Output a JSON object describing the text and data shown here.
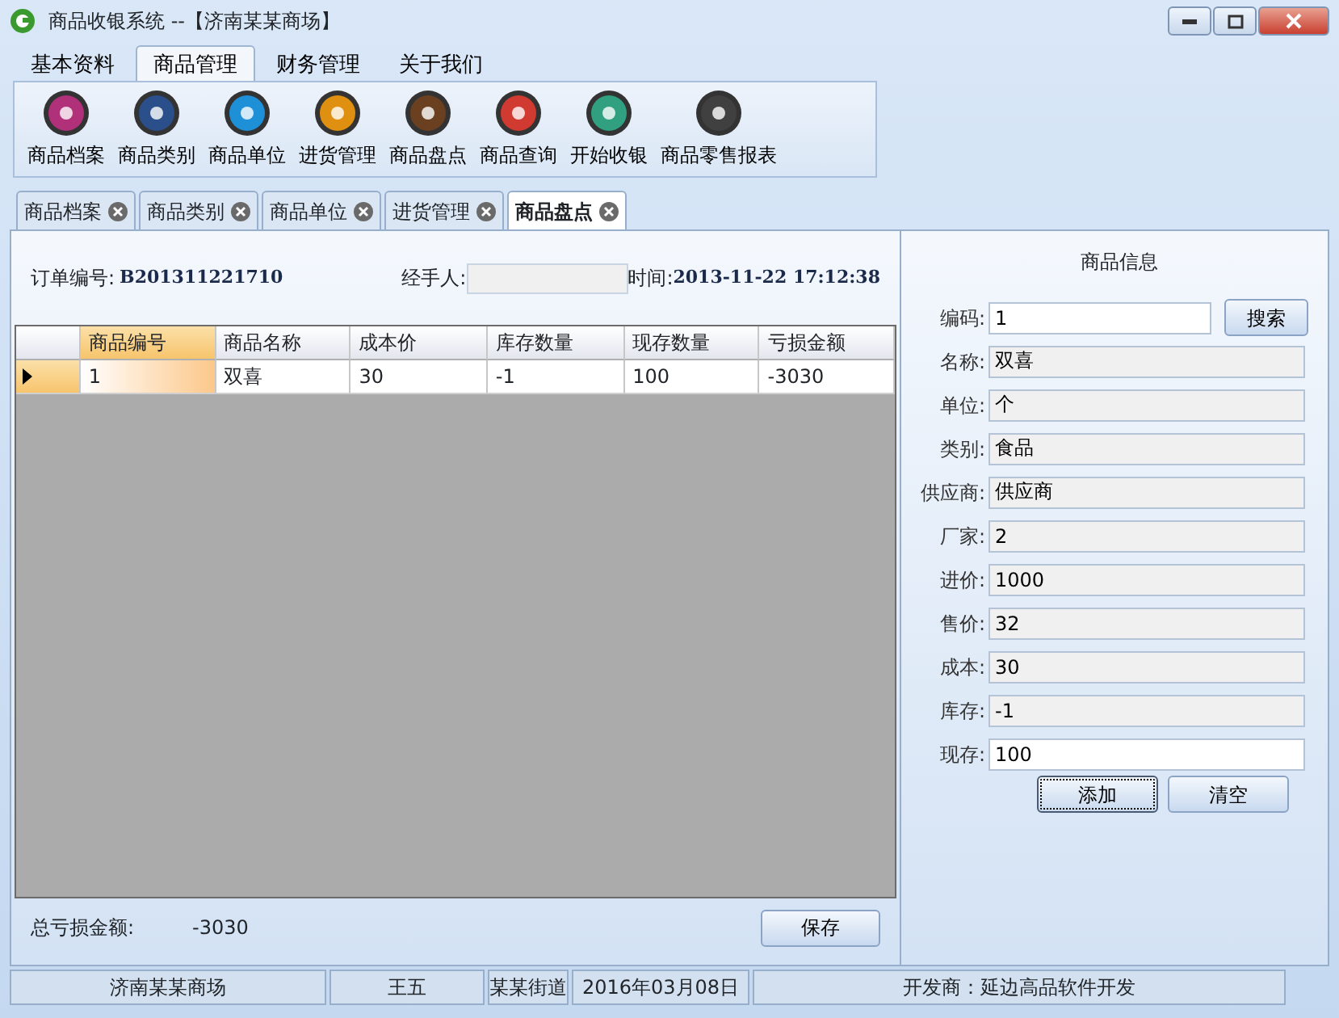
{
  "window": {
    "title": "商品收银系统 --【济南某某商场】"
  },
  "menu_tabs": [
    {
      "label": "基本资料",
      "selected": false
    },
    {
      "label": "商品管理",
      "selected": true
    },
    {
      "label": "财务管理",
      "selected": false
    },
    {
      "label": "关于我们",
      "selected": false
    }
  ],
  "ribbon_buttons": [
    {
      "label": "商品档案",
      "color": "#b0307a"
    },
    {
      "label": "商品类别",
      "color": "#2a4f8a"
    },
    {
      "label": "商品单位",
      "color": "#1e90d8"
    },
    {
      "label": "进货管理",
      "color": "#e09010"
    },
    {
      "label": "商品盘点",
      "color": "#6a4020"
    },
    {
      "label": "商品查询",
      "color": "#d03a30"
    },
    {
      "label": "开始收银",
      "color": "#30a080"
    },
    {
      "label": "商品零售报表",
      "color": "#404040"
    }
  ],
  "doc_tabs": [
    {
      "label": "商品档案",
      "selected": false
    },
    {
      "label": "商品类别",
      "selected": false
    },
    {
      "label": "商品单位",
      "selected": false
    },
    {
      "label": "进货管理",
      "selected": false
    },
    {
      "label": "商品盘点",
      "selected": true
    }
  ],
  "order": {
    "label": "订单编号:",
    "value": "B201311221710"
  },
  "handler": {
    "label": "经手人:"
  },
  "time": {
    "label": "时间:",
    "value": "2013-11-22 17:12:38"
  },
  "table": {
    "columns": [
      "商品编号",
      "商品名称",
      "成本价",
      "库存数量",
      "现存数量",
      "亏损金额"
    ],
    "rows": [
      {
        "cells": [
          "1",
          "双喜",
          "30",
          "-1",
          "100",
          "-3030"
        ],
        "selected": true
      }
    ]
  },
  "summary": {
    "label": "总亏损金额:",
    "value": "-3030"
  },
  "save_button": "保存",
  "info_panel": {
    "title": "商品信息",
    "fields": [
      {
        "label": "编码:",
        "value": "1",
        "editable": true
      },
      {
        "label": "名称:",
        "value": "双喜",
        "editable": false
      },
      {
        "label": "单位:",
        "value": "个",
        "editable": false
      },
      {
        "label": "类别:",
        "value": "食品",
        "editable": false
      },
      {
        "label": "供应商:",
        "value": "供应商",
        "editable": false
      },
      {
        "label": "厂家:",
        "value": "2",
        "editable": false
      },
      {
        "label": "进价:",
        "value": "1000",
        "editable": false
      },
      {
        "label": "售价:",
        "value": "32",
        "editable": false
      },
      {
        "label": "成本:",
        "value": "30",
        "editable": false
      },
      {
        "label": "库存:",
        "value": "-1",
        "editable": false
      },
      {
        "label": "现存:",
        "value": "100",
        "editable": true
      }
    ],
    "search_button": "搜索",
    "buttons": [
      {
        "label": "添加",
        "focused": true
      },
      {
        "label": "清空",
        "focused": false
      }
    ]
  },
  "status_bar": [
    "济南某某商场",
    "王五",
    "某某街道",
    "2016年03月08日",
    "开发商：延边高品软件开发"
  ]
}
